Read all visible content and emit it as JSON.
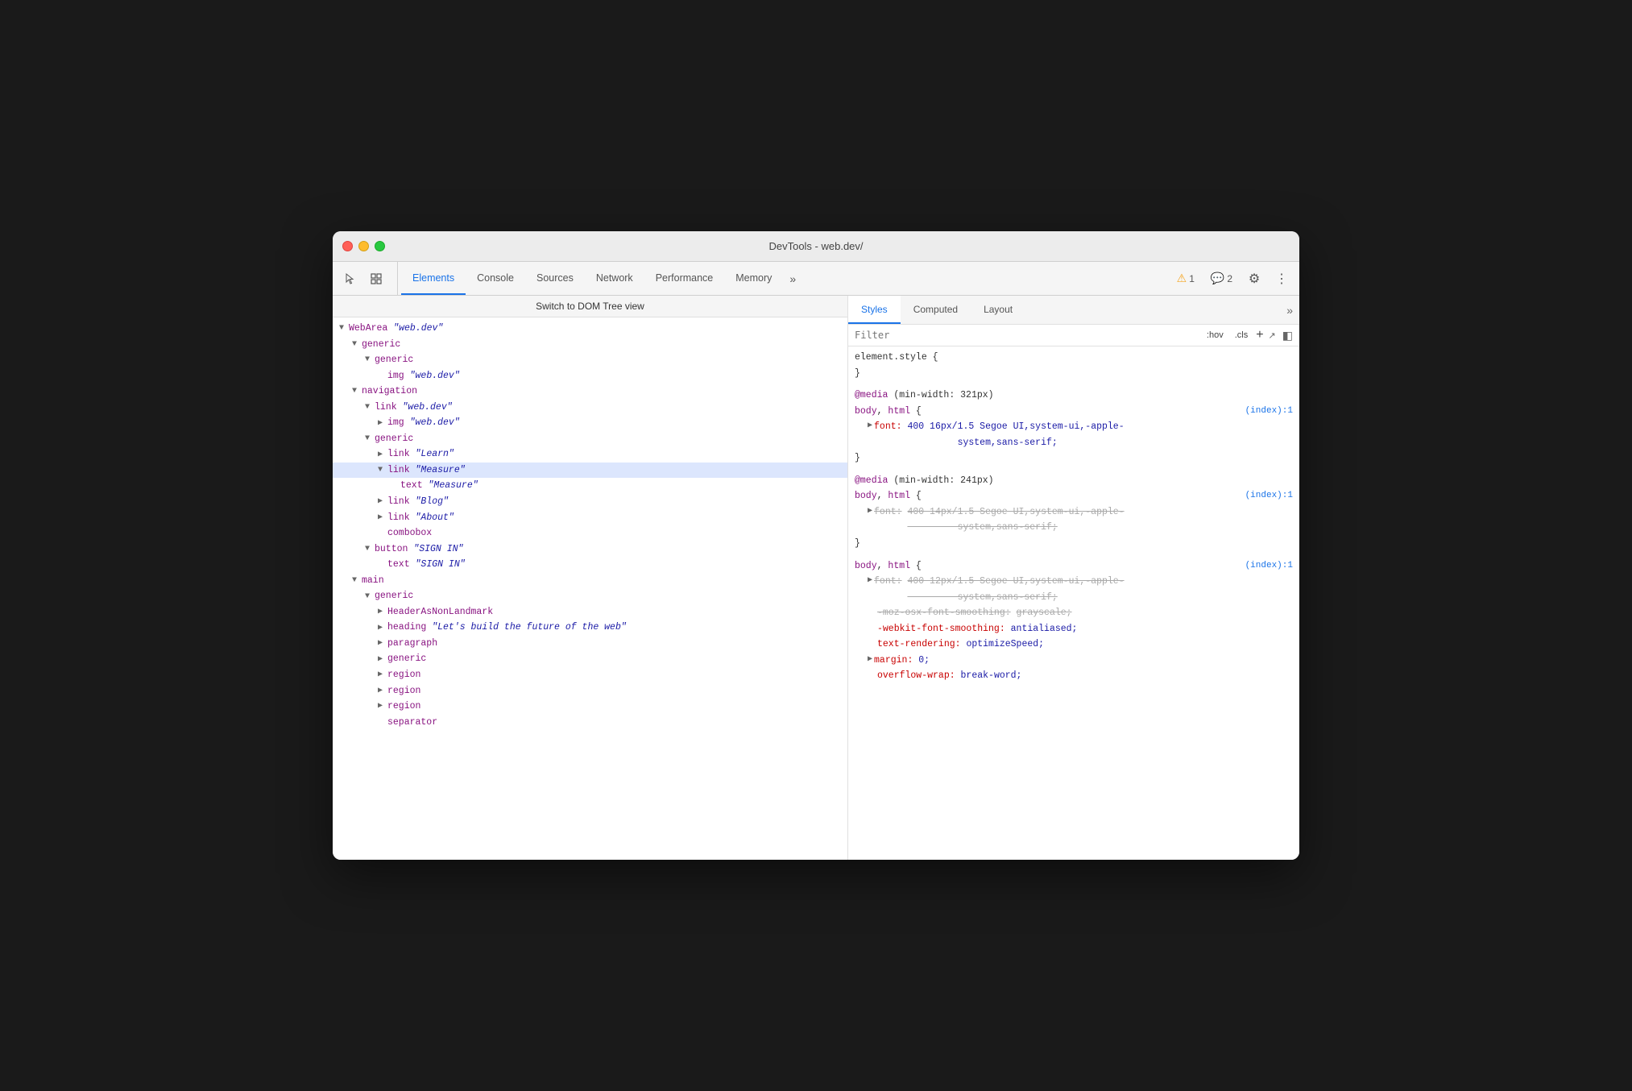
{
  "window": {
    "title": "DevTools - web.dev/"
  },
  "toolbar": {
    "tabs": [
      {
        "label": "Elements",
        "active": true
      },
      {
        "label": "Console",
        "active": false
      },
      {
        "label": "Sources",
        "active": false
      },
      {
        "label": "Network",
        "active": false
      },
      {
        "label": "Performance",
        "active": false
      },
      {
        "label": "Memory",
        "active": false
      }
    ],
    "more_tabs_icon": "»",
    "warn_badge": "1",
    "info_badge": "2",
    "gear_icon": "⚙",
    "more_icon": "⋮"
  },
  "dom_panel": {
    "switch_bar": "Switch to DOM Tree view",
    "tree": [
      {
        "indent": 0,
        "arrow": "expanded",
        "tag": "WebArea",
        "string": "\"web.dev\""
      },
      {
        "indent": 1,
        "arrow": "expanded",
        "tag": "generic"
      },
      {
        "indent": 2,
        "arrow": "expanded",
        "tag": "generic"
      },
      {
        "indent": 3,
        "arrow": "leaf",
        "tag": "img",
        "string": "\"web.dev\""
      },
      {
        "indent": 1,
        "arrow": "expanded",
        "tag": "navigation"
      },
      {
        "indent": 2,
        "arrow": "expanded",
        "tag": "link",
        "string": "\"web.dev\""
      },
      {
        "indent": 3,
        "arrow": "collapsed",
        "tag": "img",
        "string": "\"web.dev\""
      },
      {
        "indent": 2,
        "arrow": "expanded",
        "tag": "generic"
      },
      {
        "indent": 3,
        "arrow": "collapsed",
        "tag": "link",
        "string": "\"Learn\""
      },
      {
        "indent": 3,
        "arrow": "expanded",
        "tag": "link",
        "string": "\"Measure\"",
        "selected": true
      },
      {
        "indent": 4,
        "arrow": "leaf",
        "tag": "text",
        "string": "\"Measure\""
      },
      {
        "indent": 3,
        "arrow": "collapsed",
        "tag": "link",
        "string": "\"Blog\""
      },
      {
        "indent": 3,
        "arrow": "collapsed",
        "tag": "link",
        "string": "\"About\""
      },
      {
        "indent": 3,
        "arrow": "leaf",
        "tag": "combobox"
      },
      {
        "indent": 2,
        "arrow": "expanded",
        "tag": "button",
        "string": "\"SIGN IN\""
      },
      {
        "indent": 3,
        "arrow": "leaf",
        "tag": "text",
        "string": "\"SIGN IN\""
      },
      {
        "indent": 1,
        "arrow": "expanded",
        "tag": "main"
      },
      {
        "indent": 2,
        "arrow": "expanded",
        "tag": "generic"
      },
      {
        "indent": 3,
        "arrow": "collapsed",
        "tag": "HeaderAsNonLandmark"
      },
      {
        "indent": 3,
        "arrow": "collapsed",
        "tag": "heading",
        "string": "\"Let's build the future of the web\""
      },
      {
        "indent": 3,
        "arrow": "collapsed",
        "tag": "paragraph"
      },
      {
        "indent": 3,
        "arrow": "collapsed",
        "tag": "generic"
      },
      {
        "indent": 3,
        "arrow": "collapsed",
        "tag": "region"
      },
      {
        "indent": 3,
        "arrow": "collapsed",
        "tag": "region"
      },
      {
        "indent": 3,
        "arrow": "collapsed",
        "tag": "region"
      },
      {
        "indent": 3,
        "arrow": "leaf",
        "tag": "separator"
      }
    ]
  },
  "styles_panel": {
    "tabs": [
      {
        "label": "Styles",
        "active": true
      },
      {
        "label": "Computed",
        "active": false
      },
      {
        "label": "Layout",
        "active": false
      }
    ],
    "more_icon": "»",
    "filter": {
      "placeholder": "Filter",
      "hov_btn": ":hov",
      "cls_btn": ".cls"
    },
    "blocks": [
      {
        "type": "element",
        "selector": "element.style {",
        "closing": "}",
        "props": []
      },
      {
        "type": "media",
        "media_query": "@media (min-width: 321px)",
        "selector": "body, html {",
        "source": "(index):1",
        "closing": "}",
        "props": [
          {
            "name": "font:",
            "triangle": true,
            "value": "400 16px/1.5 Segoe UI,system-ui,-apple-system,sans-serif;",
            "strike": false
          }
        ]
      },
      {
        "type": "media",
        "media_query": "@media (min-width: 241px)",
        "selector": "body, html {",
        "source": "(index):1",
        "closing": "}",
        "props": [
          {
            "name": "font:",
            "triangle": true,
            "value": "400 14px/1.5 Segoe UI,system-ui,-apple-system,sans-serif;",
            "strike": true
          }
        ]
      },
      {
        "type": "rule",
        "selector": "body, html {",
        "source": "(index):1",
        "closing": "}",
        "props": [
          {
            "name": "font:",
            "triangle": true,
            "value": "400 12px/1.5 Segoe UI,system-ui,-apple-system,sans-serif;",
            "strike": true
          },
          {
            "name": "-moz-osx-font-smoothing:",
            "value": "grayscale;",
            "strike": true
          },
          {
            "name": "-webkit-font-smoothing:",
            "value": "antialiased;",
            "strike": false,
            "webkit": true
          },
          {
            "name": "text-rendering:",
            "value": "optimizeSpeed;",
            "strike": false,
            "webkit": true
          },
          {
            "name": "margin:",
            "triangle": true,
            "value": "0;",
            "strike": false,
            "webkit": true
          },
          {
            "name": "overflow-wrap:",
            "value": "break-word;",
            "strike": false,
            "webkit": true,
            "partial": true
          }
        ]
      }
    ]
  }
}
